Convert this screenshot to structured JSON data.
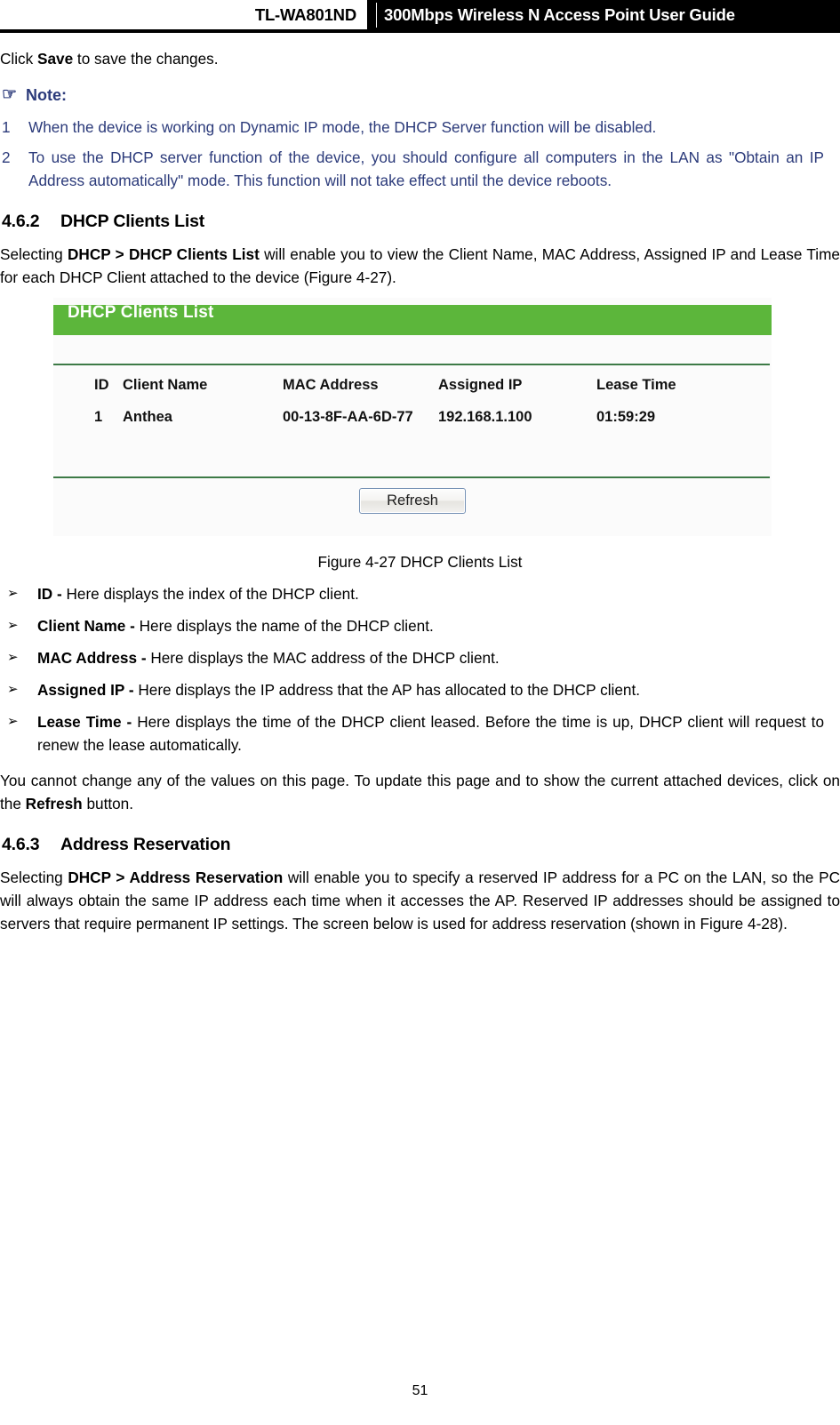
{
  "header": {
    "model": "TL-WA801ND",
    "title": "300Mbps Wireless N Access Point User Guide"
  },
  "intro": {
    "prefix": "Click ",
    "bold": "Save",
    "suffix": " to save the changes."
  },
  "note": {
    "icon": "hand-pointing-right-icon",
    "label": "Note:",
    "color": "#2b3a7a",
    "items": [
      {
        "number": "1",
        "text": "When the device is working on Dynamic IP mode, the DHCP Server function will be disabled."
      },
      {
        "number": "2",
        "text": "To use the DHCP server function of the device, you should configure all computers in the LAN as \"Obtain an IP Address automatically\" mode. This function will not take effect until the device reboots."
      }
    ]
  },
  "section_462": {
    "number": "4.6.2",
    "title": "DHCP Clients List",
    "intro": {
      "p1": "Selecting ",
      "b1": "DHCP",
      "p2": " > ",
      "b2": "DHCP Clients List",
      "p3": " will enable you to view the Client Name, MAC Address, Assigned IP and Lease Time for each DHCP Client attached to the device (Figure 4-27)."
    }
  },
  "figure": {
    "panel_title": "DHCP Clients List",
    "accent_green": "#5cb63b",
    "separator_green": "#3d7a46",
    "columns": [
      "ID",
      "Client Name",
      "MAC Address",
      "Assigned IP",
      "Lease Time"
    ],
    "rows": [
      {
        "id": "1",
        "client_name": "Anthea",
        "mac_address": "00-13-8F-AA-6D-77",
        "assigned_ip": "192.168.1.100",
        "lease_time": "01:59:29"
      }
    ],
    "refresh_label": "Refresh",
    "caption": "Figure 4-27 DHCP Clients List"
  },
  "bullets": [
    {
      "mark": "➢",
      "term": "ID - ",
      "text": "Here displays the index of the DHCP client."
    },
    {
      "mark": "➢",
      "term": "Client Name - ",
      "text": "Here displays the name of the DHCP client."
    },
    {
      "mark": "➢",
      "term": "MAC Address - ",
      "text": "Here displays the MAC address of the DHCP client."
    },
    {
      "mark": "➢",
      "term": "Assigned IP - ",
      "text": "Here displays the IP address that the AP has allocated to the DHCP client."
    },
    {
      "mark": "➢",
      "term": "Lease Time - ",
      "text": "Here displays the time of the DHCP client leased. Before the time is up, DHCP client will request to renew the lease automatically."
    }
  ],
  "after_bullets": {
    "p1": "You cannot change any of the values on this page. To update this page and to show the current attached devices, click on the ",
    "b1": "Refresh",
    "p2": " button."
  },
  "section_463": {
    "number": "4.6.3",
    "title": "Address Reservation",
    "intro": {
      "p1": "Selecting ",
      "b1": "DHCP",
      "p2": " > ",
      "b2": "Address Reservation",
      "p3": " will enable you to specify a reserved IP address for a PC on the LAN, so the PC will always obtain the same IP address each time when it accesses the AP. Reserved IP addresses should be assigned to servers that require permanent IP settings. The screen below is used for address reservation (shown in Figure 4-28)."
    }
  },
  "footer": {
    "page_number": "51"
  }
}
